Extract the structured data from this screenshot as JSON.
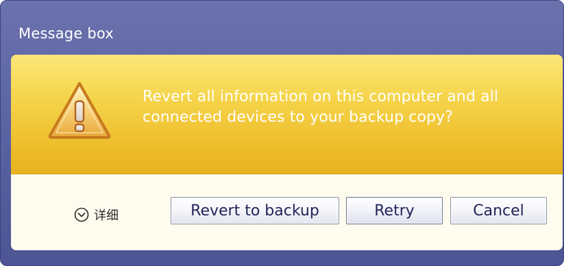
{
  "window": {
    "title": "Message box"
  },
  "message": {
    "text": "Revert all information on this computer and all connected devices to your backup copy?",
    "icon": "warning-icon"
  },
  "footer": {
    "details_label": "详细",
    "details_icon": "chevron-down-circle-icon",
    "buttons": {
      "revert": "Revert to backup",
      "retry": "Retry",
      "cancel": "Cancel"
    }
  },
  "colors": {
    "title_bar": "#5a62a2",
    "banner": "#f6d54c",
    "footer": "#fdfcef",
    "button_text": "#22245a"
  }
}
